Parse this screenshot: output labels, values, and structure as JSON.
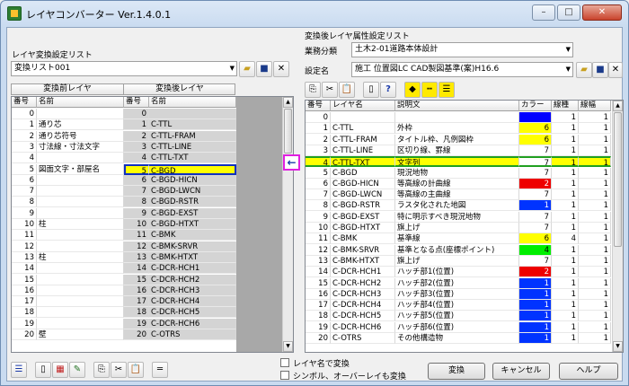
{
  "window": {
    "title": "レイヤコンバーター Ver.1.4.0.1",
    "minimize": "–",
    "maximize": "□",
    "close": "✕"
  },
  "left": {
    "list_label": "レイヤ変換設定リスト",
    "list_value": "変換リスト001",
    "group_before": "変換前レイヤ",
    "group_after": "変換後レイヤ",
    "headers": [
      "番号",
      "名前",
      "番号",
      "名前"
    ],
    "rows": [
      [
        "0",
        "",
        "0",
        ""
      ],
      [
        "1",
        "通り芯",
        "1",
        "C-TTL"
      ],
      [
        "2",
        "通り芯符号",
        "2",
        "C-TTL-FRAM"
      ],
      [
        "3",
        "寸法線・寸法文字",
        "3",
        "C-TTL-LINE"
      ],
      [
        "4",
        "",
        "4",
        "C-TTL-TXT"
      ],
      [
        "5",
        "図面文字・部屋名",
        "5",
        "C-BGD"
      ],
      [
        "6",
        "",
        "6",
        "C-BGD-HICN"
      ],
      [
        "7",
        "",
        "7",
        "C-BGD-LWCN"
      ],
      [
        "8",
        "",
        "8",
        "C-BGD-RSTR"
      ],
      [
        "9",
        "",
        "9",
        "C-BGD-EXST"
      ],
      [
        "10",
        "柱",
        "10",
        "C-BGD-HTXT"
      ],
      [
        "11",
        "",
        "11",
        "C-BMK"
      ],
      [
        "12",
        "",
        "12",
        "C-BMK-SRVR"
      ],
      [
        "13",
        "柱",
        "13",
        "C-BMK-HTXT"
      ],
      [
        "14",
        "",
        "14",
        "C-DCR-HCH1"
      ],
      [
        "15",
        "",
        "15",
        "C-DCR-HCH2"
      ],
      [
        "16",
        "",
        "16",
        "C-DCR-HCH3"
      ],
      [
        "17",
        "",
        "17",
        "C-DCR-HCH4"
      ],
      [
        "18",
        "",
        "18",
        "C-DCR-HCH5"
      ],
      [
        "19",
        "",
        "19",
        "C-DCR-HCH6"
      ],
      [
        "20",
        "壁",
        "20",
        "C-OTRS"
      ]
    ]
  },
  "right": {
    "attr_label": "変換後レイヤ属性設定リスト",
    "biz_label": "業務分類",
    "biz_value": "土木2-01道路本体設計",
    "set_label": "設定名",
    "set_value": "施工 位置図LC CAD製図基準(案)H16.6",
    "headers": [
      "番号",
      "レイヤ名",
      "説明文",
      "カラー",
      "線種",
      "線幅"
    ],
    "rows": [
      [
        "0",
        "",
        "",
        "",
        "1",
        "1"
      ],
      [
        "1",
        "C-TTL",
        "外枠",
        "6",
        "1",
        "1"
      ],
      [
        "2",
        "C-TTL-FRAM",
        "タイトル枠、凡例図枠",
        "6",
        "1",
        "1"
      ],
      [
        "3",
        "C-TTL-LINE",
        "区切り線、罫線",
        "7",
        "1",
        "1"
      ],
      [
        "4",
        "C-TTL-TXT",
        "文字列",
        "7",
        "1",
        "1"
      ],
      [
        "5",
        "C-BGD",
        "現況地物",
        "7",
        "1",
        "1"
      ],
      [
        "6",
        "C-BGD-HICN",
        "等高線の計曲線",
        "2",
        "1",
        "1"
      ],
      [
        "7",
        "C-BGD-LWCN",
        "等高線の主曲線",
        "7",
        "1",
        "1"
      ],
      [
        "8",
        "C-BGD-RSTR",
        "ラスタ化された地図",
        "1",
        "1",
        "1"
      ],
      [
        "9",
        "C-BGD-EXST",
        "特に明示すべき現況地物",
        "7",
        "1",
        "1"
      ],
      [
        "10",
        "C-BGD-HTXT",
        "旗上げ",
        "7",
        "1",
        "1"
      ],
      [
        "11",
        "C-BMK",
        "基準線",
        "6",
        "4",
        "1"
      ],
      [
        "12",
        "C-BMK-SRVR",
        "基準となる点(座標ポイント)",
        "4",
        "1",
        "1"
      ],
      [
        "13",
        "C-BMK-HTXT",
        "旗上げ",
        "7",
        "1",
        "1"
      ],
      [
        "14",
        "C-DCR-HCH1",
        "ハッチ部1(位置)",
        "2",
        "1",
        "1"
      ],
      [
        "15",
        "C-DCR-HCH2",
        "ハッチ部2(位置)",
        "1",
        "1",
        "1"
      ],
      [
        "16",
        "C-DCR-HCH3",
        "ハッチ部3(位置)",
        "1",
        "1",
        "1"
      ],
      [
        "17",
        "C-DCR-HCH4",
        "ハッチ部4(位置)",
        "1",
        "1",
        "1"
      ],
      [
        "18",
        "C-DCR-HCH5",
        "ハッチ部5(位置)",
        "1",
        "1",
        "1"
      ],
      [
        "19",
        "C-DCR-HCH6",
        "ハッチ部6(位置)",
        "1",
        "1",
        "1"
      ],
      [
        "20",
        "C-OTRS",
        "その他構造物",
        "1",
        "1",
        "1"
      ]
    ]
  },
  "palette": {
    "0": "#0000ff",
    "1": "#0033ff",
    "2": "#ee0000",
    "4": "#00ee00",
    "6": "#ffff00",
    "7": "#ffffff"
  },
  "arrow_button": "←",
  "options": {
    "layer_name_convert": "レイヤ名で変換",
    "symbol_convert": "シンボル、オーバーレイも変換"
  },
  "buttons": {
    "convert": "変換",
    "cancel": "キャンセル",
    "help": "ヘルプ"
  }
}
